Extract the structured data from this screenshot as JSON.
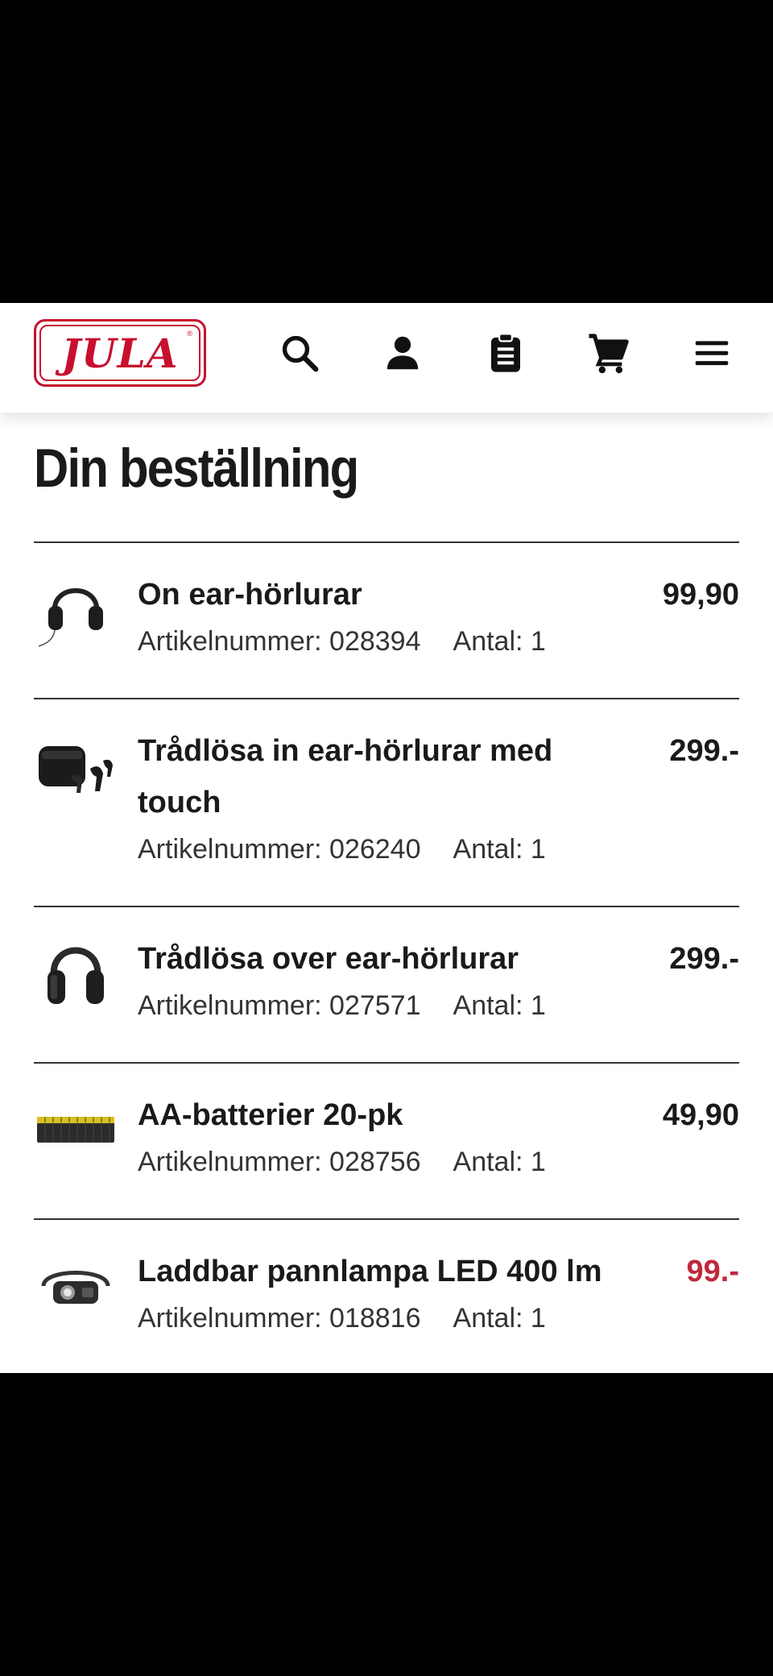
{
  "header": {
    "logo_text": "JULA",
    "logo_reg": "®"
  },
  "nav": {
    "icons": [
      "search-icon",
      "account-icon",
      "clipboard-icon",
      "cart-icon",
      "menu-icon"
    ]
  },
  "page": {
    "title": "Din beställning"
  },
  "labels": {
    "article_number": "Artikelnummer:",
    "quantity": "Antal:"
  },
  "colors": {
    "brand_red": "#c8102e",
    "sale_price": "#c0283c"
  },
  "items": [
    {
      "name": "On ear-hörlurar",
      "article_text": "Artikelnummer: 028394",
      "quantity_text": "Antal: 1",
      "price": "99,90",
      "image": "headphones-corded"
    },
    {
      "name": "Trådlösa in ear-hörlurar med touch",
      "article_text": "Artikelnummer: 026240",
      "quantity_text": "Antal: 1",
      "price": "299.-",
      "image": "earbuds-case"
    },
    {
      "name": "Trådlösa over ear-hörlurar",
      "article_text": "Artikelnummer: 027571",
      "quantity_text": "Antal: 1",
      "price": "299.-",
      "image": "headphones-wireless"
    },
    {
      "name": "AA-batterier 20-pk",
      "article_text": "Artikelnummer: 028756",
      "quantity_text": "Antal: 1",
      "price": "49,90",
      "image": "batteries-pack"
    },
    {
      "name": "Laddbar pannlampa LED 400 lm",
      "article_text": "Artikelnummer: 018816",
      "quantity_text": "Antal: 1",
      "price": "99.-",
      "price_sale": true,
      "image": "headlamp"
    }
  ]
}
